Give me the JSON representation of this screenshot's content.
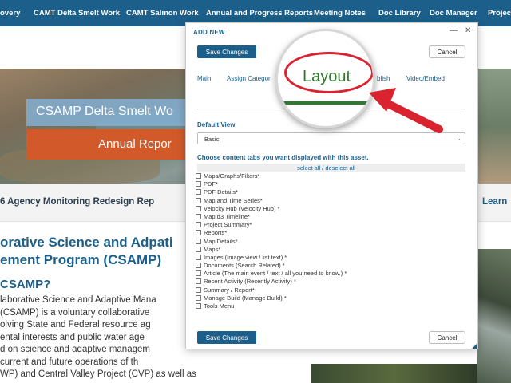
{
  "nav": {
    "items": [
      "overy",
      "CAMT Delta Smelt Work",
      "CAMT Salmon Work",
      "Annual and Progress Reports",
      "Meeting Notes",
      "Doc Library",
      "Doc Manager",
      "Projec"
    ]
  },
  "banner": {
    "title": "CSAMP Delta Smelt Wo",
    "subtitle": "Annual Repor"
  },
  "strip": {
    "left": "6 Agency Monitoring Redesign Rep",
    "right": "Learn"
  },
  "article": {
    "headline_line1": "orative Science and Adpati",
    "headline_line2": "ement  Program (CSAMP)",
    "subhead": "CSAMP?",
    "lines": [
      "laborative Science and Adaptive Mana",
      "(CSAMP) is a voluntary collaborative",
      "olving State and Federal resource ag",
      "ental interests and public water age",
      "d on science and adaptive managem",
      "current and future operations of th",
      "WP) and Central Valley Project (CVP) as well as"
    ]
  },
  "modal": {
    "title": "ADD NEW",
    "minimize": "—",
    "close": "✕",
    "save_label": "Save Changes",
    "cancel_label": "Cancel",
    "tabs": [
      "Main",
      "Assign Categor",
      "blish",
      "Video/Embed"
    ],
    "default_view_label": "Default View",
    "default_view_value": "Basic",
    "content_tabs_label": "Choose content tabs you want displayed with this asset.",
    "select_all": "select all / deselect all",
    "checklist": [
      "Maps/Graphs/Filters*",
      "PDF*",
      "PDF Details*",
      "Map and Time Series*",
      "Velocity Hub (Velocity Hub) *",
      "Map d3 Timeline*",
      "Project Summary*",
      "Reports*",
      "Map Details*",
      "Maps*",
      "Images (Image view / list text) *",
      "Documents (Search Related) *",
      "Article (The main event / text / all you need to know.) *",
      "Recent Activity (Recently Activity) *",
      "Summary / Report*",
      "Manage Build (Manage Build) *",
      "Tools Menu"
    ]
  },
  "callout": {
    "label": "Layout",
    "highlight_color": "#d9242f",
    "text_color": "#2f7a2f"
  },
  "colors": {
    "brand_blue": "#1b5f8a",
    "accent_orange": "#d25a2a",
    "arrow_red": "#d9242f"
  }
}
